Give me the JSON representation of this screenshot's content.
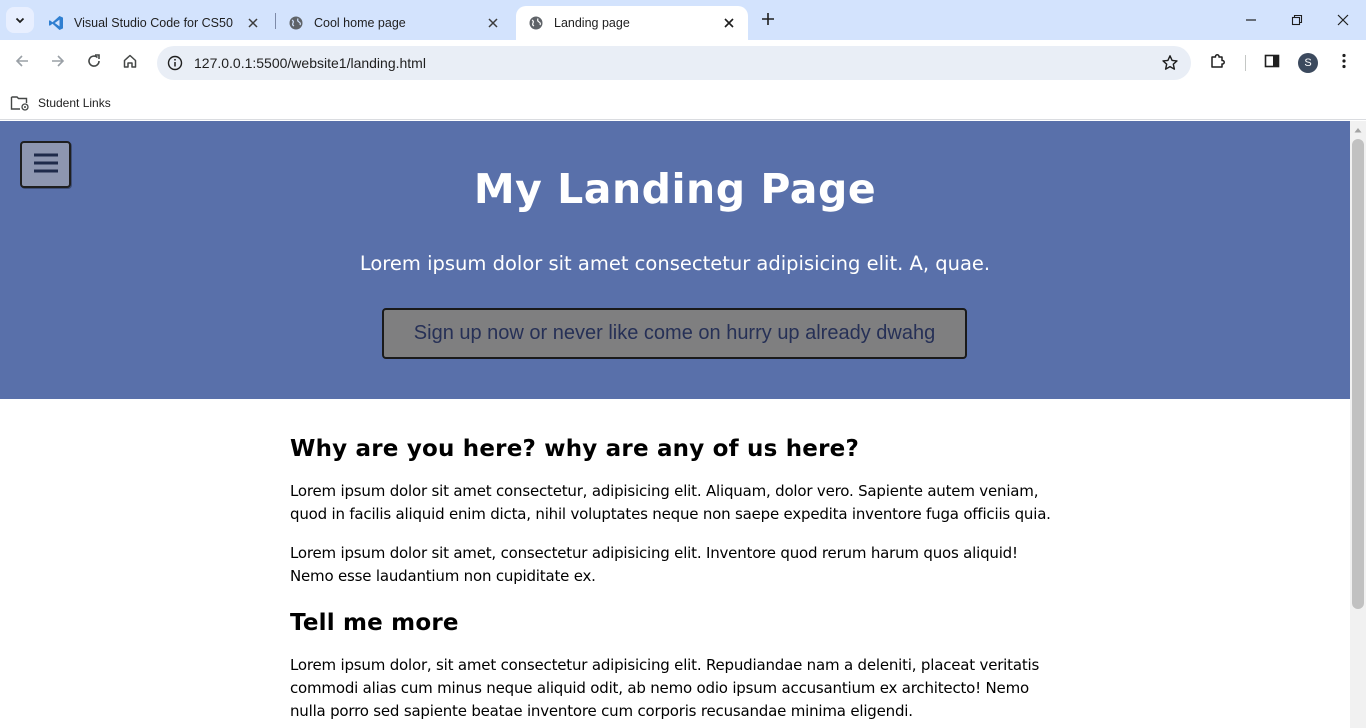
{
  "browser": {
    "tabs": [
      {
        "title": "Visual Studio Code for CS50",
        "icon": "vscode-icon",
        "active": false
      },
      {
        "title": "Cool home page",
        "icon": "globe-icon",
        "active": false
      },
      {
        "title": "Landing page",
        "icon": "globe-icon",
        "active": true
      }
    ],
    "url": "127.0.0.1:5500/website1/landing.html",
    "profile_initial": "S",
    "bookmarks": [
      {
        "label": "Student Links",
        "icon": "managed-folder-icon"
      }
    ]
  },
  "page": {
    "hero": {
      "menu_icon": "☰",
      "title": "My Landing Page",
      "subtitle": "Lorem ipsum dolor sit amet consectetur adipisicing elit. A, quae.",
      "cta_label": "Sign up now or never like come on hurry up already dwahg",
      "background": "#5970aa"
    },
    "sections": [
      {
        "heading": "Why are you here? why are any of us here?",
        "paragraphs": [
          "Lorem ipsum dolor sit amet consectetur, adipisicing elit. Aliquam, dolor vero. Sapiente autem veniam, quod in facilis aliquid enim dicta, nihil voluptates neque non saepe expedita inventore fuga officiis quia.",
          "Lorem ipsum dolor sit amet, consectetur adipisicing elit. Inventore quod rerum harum quos aliquid! Nemo esse laudantium non cupiditate ex."
        ]
      },
      {
        "heading": "Tell me more",
        "paragraphs": [
          "Lorem ipsum dolor, sit amet consectetur adipisicing elit. Repudiandae nam a deleniti, placeat veritatis commodi alias cum minus neque aliquid odit, ab nemo odio ipsum accusantium ex architecto! Nemo nulla porro sed sapiente beatae inventore cum corporis recusandae minima eligendi."
        ]
      }
    ]
  }
}
